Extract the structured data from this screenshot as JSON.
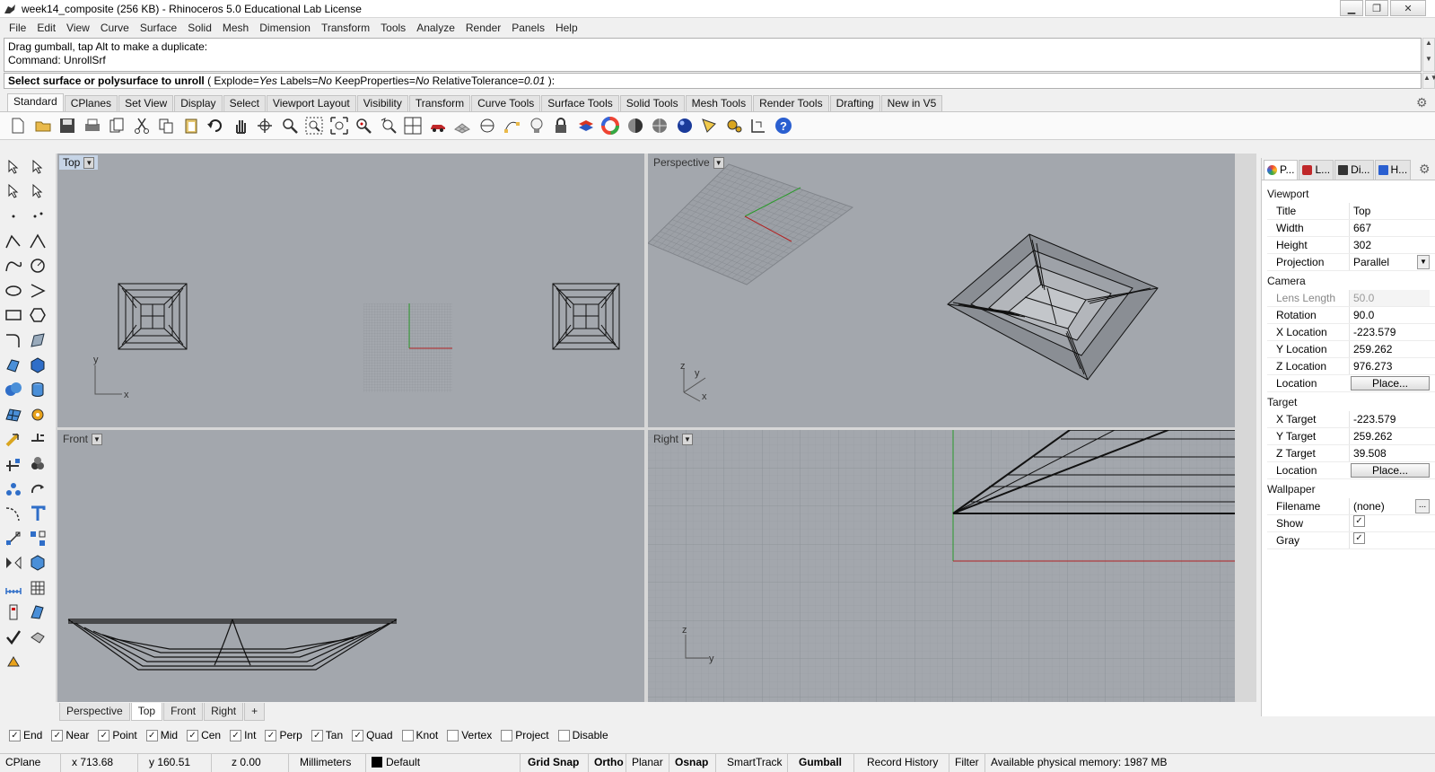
{
  "window": {
    "title": "week14_composite (256 KB) - Rhinoceros 5.0 Educational Lab License",
    "minimize": "▁",
    "maximize": "❐",
    "close": "✕"
  },
  "menu": [
    "File",
    "Edit",
    "View",
    "Curve",
    "Surface",
    "Solid",
    "Mesh",
    "Dimension",
    "Transform",
    "Tools",
    "Analyze",
    "Render",
    "Panels",
    "Help"
  ],
  "command": {
    "history_line1": "Drag gumball, tap Alt to make a duplicate:",
    "history_line2": "Command: UnrollSrf",
    "prompt": "Select surface or polysurface to unroll",
    "opt_open": "(",
    "opt1_key": "Explode=",
    "opt1_val": "Yes",
    "opt2_key": "Labels=",
    "opt2_val": "No",
    "opt3_key": "KeepProperties=",
    "opt3_val": "No",
    "opt4_key": "RelativeTolerance=",
    "opt4_val": "0.01",
    "opt_close": "):"
  },
  "toolbar_tabs": [
    "Standard",
    "CPlanes",
    "Set View",
    "Display",
    "Select",
    "Viewport Layout",
    "Visibility",
    "Transform",
    "Curve Tools",
    "Surface Tools",
    "Solid Tools",
    "Mesh Tools",
    "Render Tools",
    "Drafting",
    "New in V5"
  ],
  "toolbar_icons": [
    "new-file-icon",
    "open-file-icon",
    "save-icon",
    "print-icon",
    "import-icon",
    "cut-icon",
    "copy-icon",
    "paste-icon",
    "undo-icon",
    "pan-icon",
    "rotate-view-icon",
    "zoom-dynamic-icon",
    "zoom-window-icon",
    "zoom-extents-icon",
    "zoom-selected-icon",
    "undo-view-icon",
    "four-viewports-icon",
    "car-icon",
    "grid-icon",
    "circle-tool-icon",
    "edit-points-icon",
    "light-icon",
    "lock-icon",
    "layer-icon",
    "color-wheel-icon",
    "shade-icon",
    "rendered-icon",
    "render-sphere-icon",
    "point-cloud-icon",
    "options-icon",
    "dimension-icon",
    "help-icon"
  ],
  "viewports": {
    "top": {
      "label": "Top",
      "axis_x": "x",
      "axis_y": "y"
    },
    "perspective": {
      "label": "Perspective",
      "axis_x": "x",
      "axis_y": "y",
      "axis_z": "z"
    },
    "front": {
      "label": "Front"
    },
    "right": {
      "label": "Right",
      "axis_y": "y",
      "axis_z": "z"
    }
  },
  "viewport_tabs": [
    "Perspective",
    "Top",
    "Front",
    "Right"
  ],
  "viewport_tab_add": "+",
  "osnaps": [
    {
      "label": "End",
      "checked": true
    },
    {
      "label": "Near",
      "checked": true
    },
    {
      "label": "Point",
      "checked": true
    },
    {
      "label": "Mid",
      "checked": true
    },
    {
      "label": "Cen",
      "checked": true
    },
    {
      "label": "Int",
      "checked": true
    },
    {
      "label": "Perp",
      "checked": true
    },
    {
      "label": "Tan",
      "checked": true
    },
    {
      "label": "Quad",
      "checked": true
    },
    {
      "label": "Knot",
      "checked": false
    },
    {
      "label": "Vertex",
      "checked": false
    },
    {
      "label": "Project",
      "checked": false
    },
    {
      "label": "Disable",
      "checked": false
    }
  ],
  "status": {
    "cplane": "CPlane",
    "x": "x 713.68",
    "y": "y 160.51",
    "z": "z 0.00",
    "units": "Millimeters",
    "layer": "Default",
    "grid_snap": "Grid Snap",
    "ortho": "Ortho",
    "planar": "Planar",
    "osnap": "Osnap",
    "smarttrack": "SmartTrack",
    "gumball": "Gumball",
    "record_history": "Record History",
    "filter": "Filter",
    "memory": "Available physical memory: 1987 MB"
  },
  "panel": {
    "tabs": [
      "P...",
      "L...",
      "Di...",
      "H..."
    ],
    "viewport_section": "Viewport",
    "title_k": "Title",
    "title_v": "Top",
    "width_k": "Width",
    "width_v": "667",
    "height_k": "Height",
    "height_v": "302",
    "projection_k": "Projection",
    "projection_v": "Parallel",
    "camera_section": "Camera",
    "lens_k": "Lens Length",
    "lens_v": "50.0",
    "rotation_k": "Rotation",
    "rotation_v": "90.0",
    "xloc_k": "X Location",
    "xloc_v": "-223.579",
    "yloc_k": "Y Location",
    "yloc_v": "259.262",
    "zloc_k": "Z Location",
    "zloc_v": "976.273",
    "location_k": "Location",
    "place_btn": "Place...",
    "target_section": "Target",
    "xt_k": "X Target",
    "xt_v": "-223.579",
    "yt_k": "Y Target",
    "yt_v": "259.262",
    "zt_k": "Z Target",
    "zt_v": "39.508",
    "tlocation_k": "Location",
    "tplace_btn": "Place...",
    "wallpaper_section": "Wallpaper",
    "filename_k": "Filename",
    "filename_v": "(none)",
    "filename_btn": "...",
    "show_k": "Show",
    "show_checked": true,
    "gray_k": "Gray",
    "gray_checked": true
  }
}
